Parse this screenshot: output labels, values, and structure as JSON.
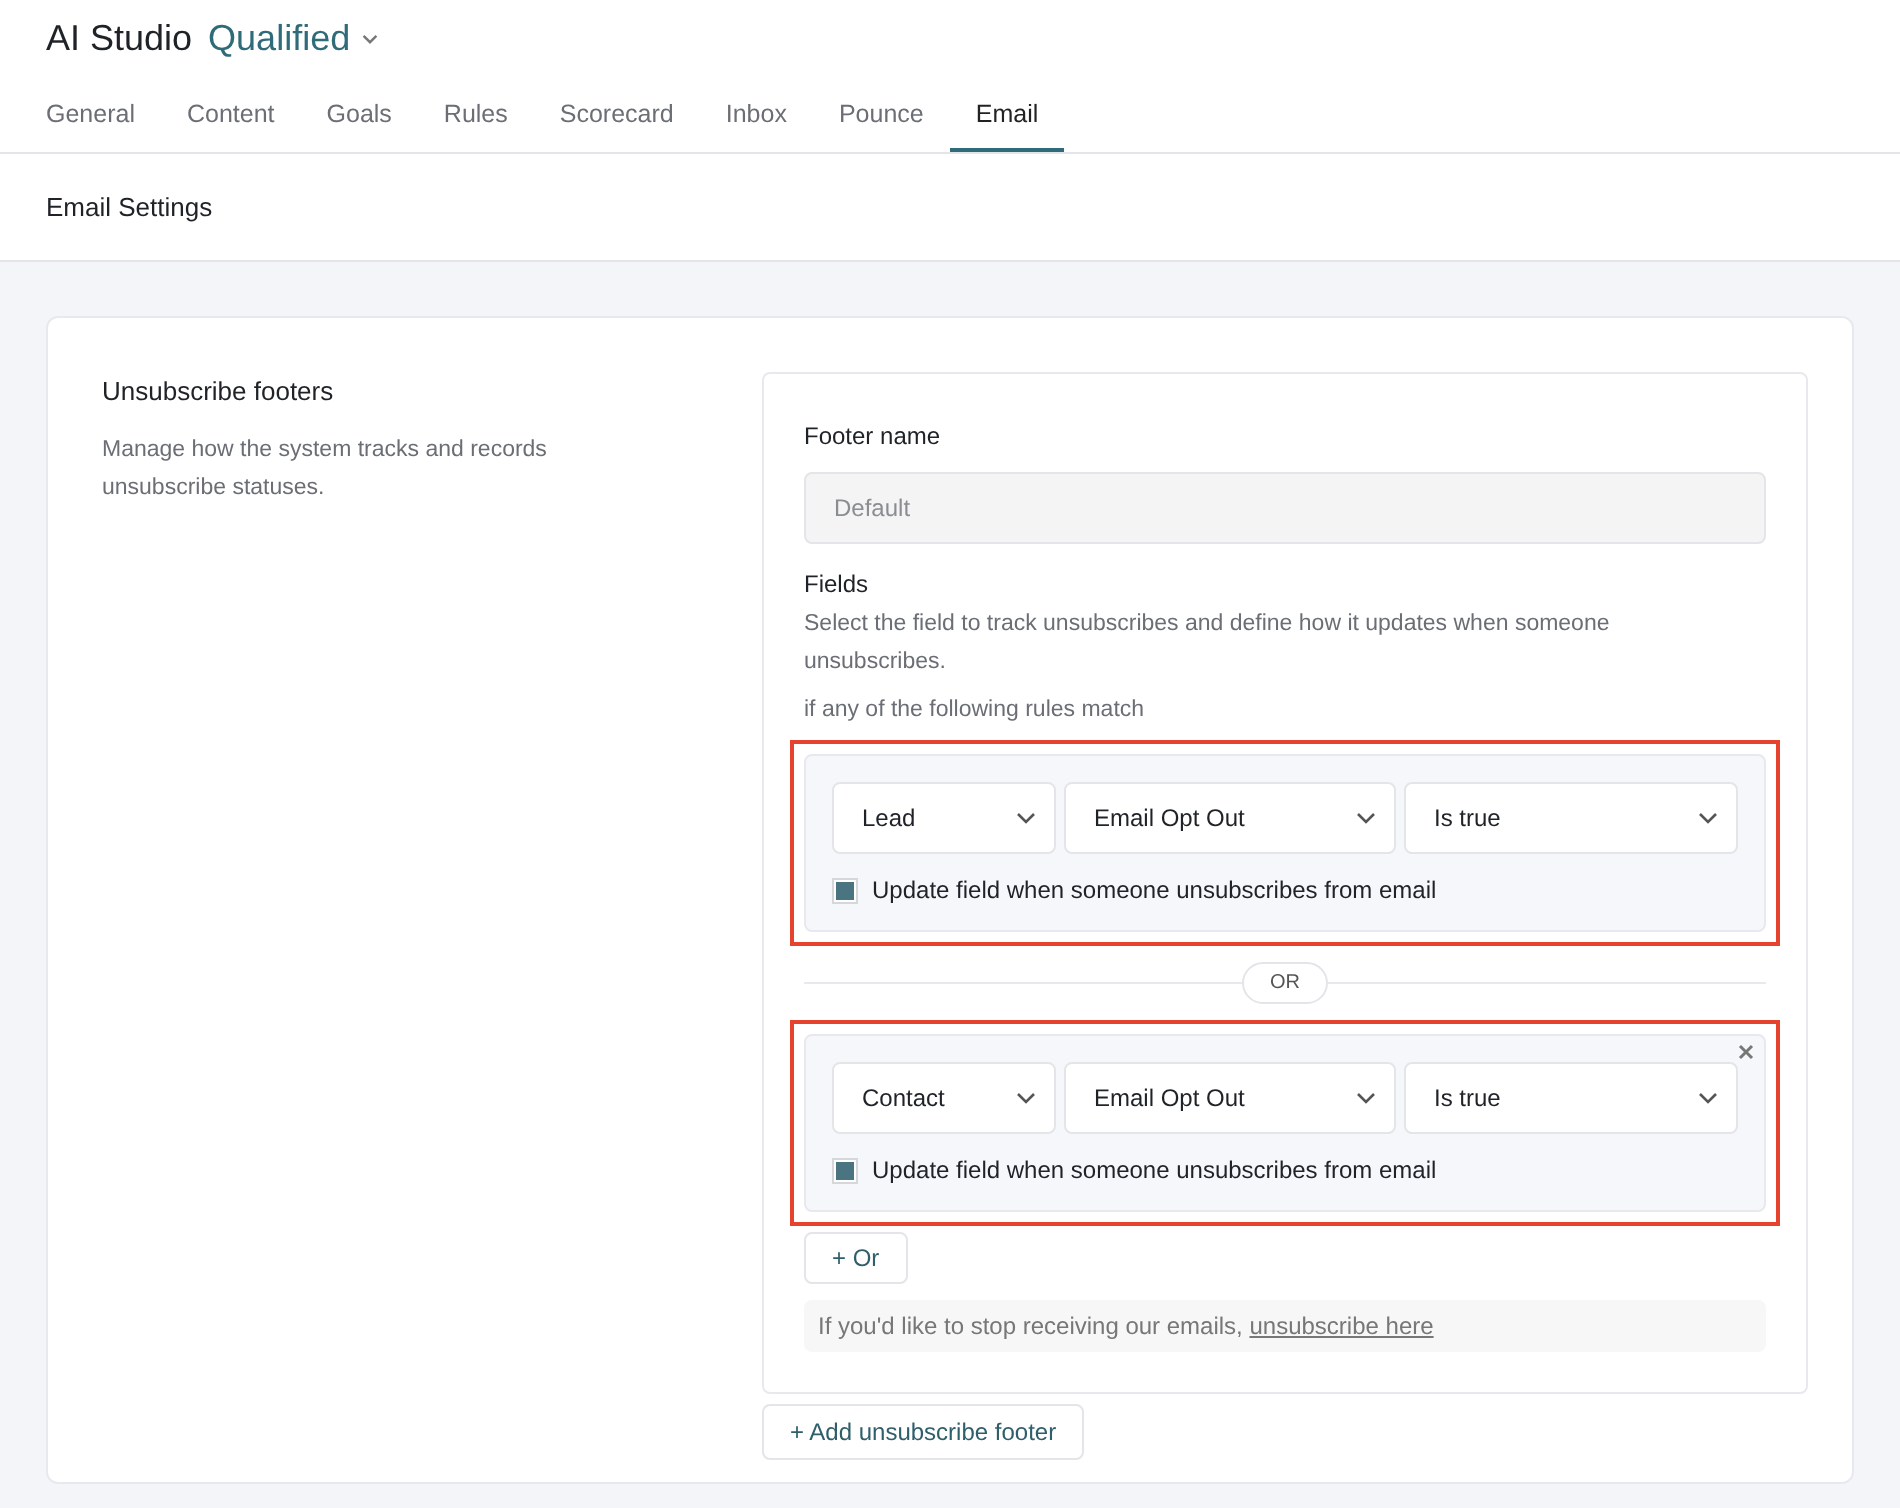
{
  "header": {
    "title": "AI Studio",
    "workspace": "Qualified"
  },
  "tabs": [
    {
      "label": "General",
      "selected": false
    },
    {
      "label": "Content",
      "selected": false
    },
    {
      "label": "Goals",
      "selected": false
    },
    {
      "label": "Rules",
      "selected": false
    },
    {
      "label": "Scorecard",
      "selected": false
    },
    {
      "label": "Inbox",
      "selected": false
    },
    {
      "label": "Pounce",
      "selected": false
    },
    {
      "label": "Email",
      "selected": true
    }
  ],
  "section_title": "Email Settings",
  "settings": {
    "title": "Unsubscribe footers",
    "description": "Manage how the system tracks and records unsubscribe statuses.",
    "footer_name": {
      "label": "Footer name",
      "value": "Default"
    },
    "fields": {
      "label": "Fields",
      "description": "Select the field to track unsubscribes and define how it updates when someone unsubscribes.",
      "match_text": "if any of the following rules match",
      "rules": [
        {
          "object": "Lead",
          "field": "Email Opt Out",
          "condition": "Is true",
          "update_label": "Update field when someone unsubscribes from email",
          "checked": true,
          "removable": false,
          "highlighted": true
        },
        {
          "object": "Contact",
          "field": "Email Opt Out",
          "condition": "Is true",
          "update_label": "Update field when someone unsubscribes from email",
          "checked": true,
          "removable": true,
          "highlighted": true
        }
      ],
      "separator": "OR",
      "add_or": "+ Or"
    },
    "preview": {
      "text": "If you'd like to stop receiving our emails,",
      "link": "unsubscribe here"
    },
    "add_footer": "+ Add unsubscribe footer"
  }
}
